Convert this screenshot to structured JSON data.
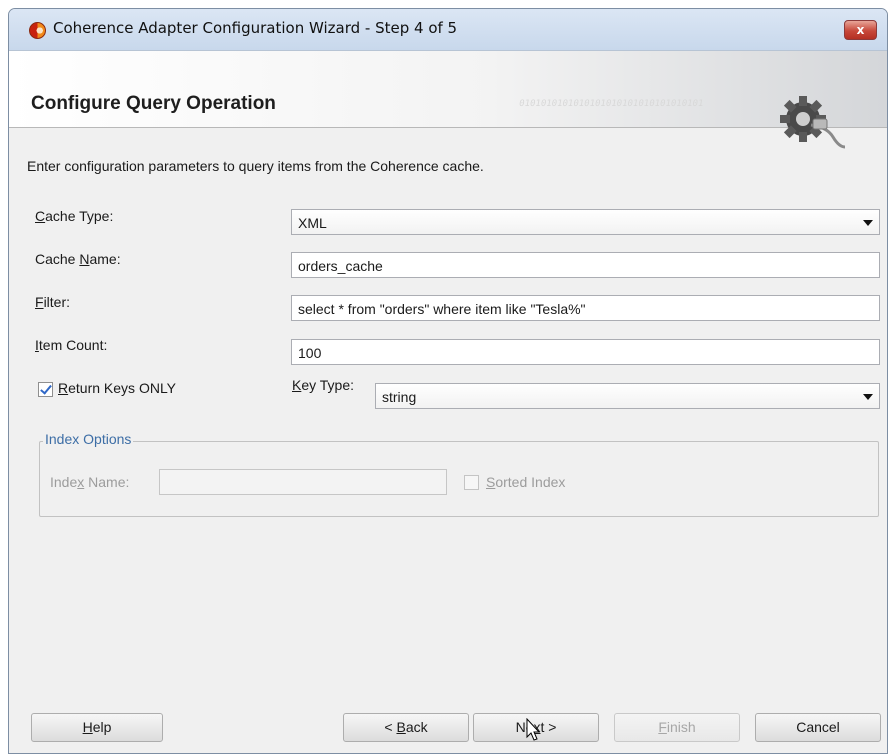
{
  "window": {
    "title": "Coherence Adapter Configuration Wizard - Step 4 of 5",
    "close_label": "x"
  },
  "banner": {
    "title": "Configure Query Operation",
    "binary_pattern": "0101010101010101010101010101010101"
  },
  "intro": "Enter configuration parameters to query items from the Coherence cache.",
  "form": {
    "cache_type": {
      "label_pre": "",
      "label_key": "C",
      "label_post": "ache Type:",
      "value": "XML"
    },
    "cache_name": {
      "label_pre": "Cache ",
      "label_key": "N",
      "label_post": "ame:",
      "value": "orders_cache"
    },
    "filter": {
      "label_pre": "",
      "label_key": "F",
      "label_post": "ilter:",
      "value": "select * from \"orders\" where item like \"Tesla%\""
    },
    "item_count": {
      "label_pre": "",
      "label_key": "I",
      "label_post": "tem Count:",
      "value": "100"
    },
    "return_keys": {
      "label_pre": "",
      "label_key": "R",
      "label_post": "eturn Keys ONLY",
      "checked": true
    },
    "key_type": {
      "label_pre": "",
      "label_key": "K",
      "label_post": "ey Type:",
      "value": "string"
    }
  },
  "index_options": {
    "legend": "Index Options",
    "index_name": {
      "label_pre": "Inde",
      "label_key": "x",
      "label_post": " Name:",
      "value": ""
    },
    "sorted_index": {
      "label_pre": "",
      "label_key": "S",
      "label_post": "orted Index",
      "checked": false
    }
  },
  "buttons": {
    "help": {
      "pre": "",
      "key": "H",
      "post": "elp"
    },
    "back": {
      "pre": "< ",
      "key": "B",
      "post": "ack"
    },
    "next": {
      "pre": "Ne",
      "key": "x",
      "post": "t >"
    },
    "finish": {
      "pre": "",
      "key": "F",
      "post": "inish"
    },
    "cancel": {
      "pre": "",
      "key": "",
      "post": "Cancel"
    }
  },
  "colors": {
    "accent_text": "#3d6ea6",
    "check_mark": "#2f67c7",
    "close_button": "#c7483a"
  }
}
